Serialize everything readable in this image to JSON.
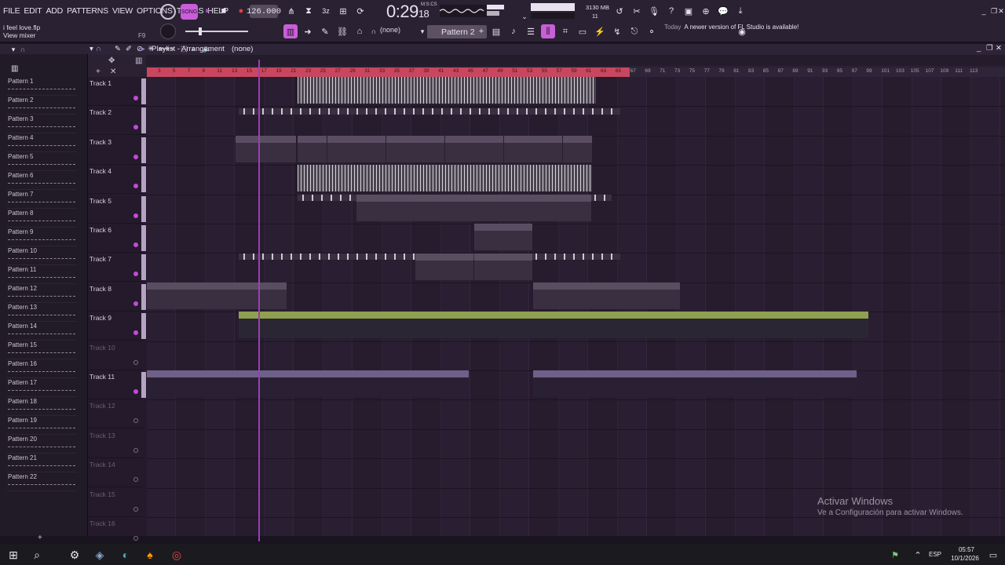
{
  "menu": [
    "FILE",
    "EDIT",
    "ADD",
    "PATTERNS",
    "VIEW",
    "OPTIONS",
    "TOOLS",
    "HELP"
  ],
  "project_file": "i feel love.flp",
  "hint": "View mixer",
  "hint_key": "F9",
  "tempo": "126.000",
  "clock": {
    "main": "0:29",
    "sub": "18",
    "label": "M:S:CS"
  },
  "memory": "3130 MB",
  "cpu": "11",
  "snap": "(none)",
  "pattern_selector": "Pattern 2",
  "notice": {
    "when": "Today",
    "text": "A newer version of FL Studio is available!"
  },
  "playlist": {
    "title": "Playlist - Arrangement",
    "arrangement": "(none)"
  },
  "ruler_ticks": [
    "3",
    "5",
    "7",
    "9",
    "11",
    "13",
    "15",
    "17",
    "19",
    "21",
    "23",
    "25",
    "27",
    "29",
    "31",
    "33",
    "35",
    "37",
    "39",
    "41",
    "43",
    "45",
    "47",
    "49",
    "51",
    "53",
    "55",
    "57",
    "59",
    "61",
    "63",
    "65",
    "67",
    "69",
    "71",
    "73",
    "75",
    "77",
    "79",
    "81",
    "83",
    "85",
    "87",
    "89",
    "91",
    "93",
    "95",
    "97",
    "99",
    "101",
    "103",
    "105",
    "107",
    "109",
    "111",
    "113"
  ],
  "patterns": [
    "Pattern 1",
    "Pattern 2",
    "Pattern 3",
    "Pattern 4",
    "Pattern 5",
    "Pattern 6",
    "Pattern 7",
    "Pattern 8",
    "Pattern 9",
    "Pattern 10",
    "Pattern 11",
    "Pattern 12",
    "Pattern 13",
    "Pattern 14",
    "Pattern 15",
    "Pattern 16",
    "Pattern 17",
    "Pattern 18",
    "Pattern 19",
    "Pattern 20",
    "Pattern 21",
    "Pattern 22"
  ],
  "tracks": [
    "Track 1",
    "Track 2",
    "Track 3",
    "Track 4",
    "Track 5",
    "Track 6",
    "Track 7",
    "Track 8",
    "Track 9",
    "Track 10",
    "Track 11",
    "Track 12",
    "Track 13",
    "Track 14",
    "Track 15",
    "Track 16"
  ],
  "clips": {
    "vox": "TPS - Voy... (124 BPM)",
    "patt12": "Patt...12",
    "patt19": "Patt...19",
    "patt17": "Patt...17",
    "patt18": "Patt...18",
    "patt13": "Patt...13",
    "patt14": "Patt...14",
    "patrn5a": "Pat...rn 5",
    "patrn5b": "Pat...rn 5",
    "patrn6a": "Pat...rn 6",
    "patrn6b": "Pat...rn 6",
    "p7a": "Pattern 7",
    "p7b": "Pattern 7",
    "eq": "Param. EQ 2 - Insert 15 - Band 1 freq",
    "pan1": "Insert 9 - Panning",
    "pan2": "Insert 9 - Panning"
  },
  "watermark": {
    "title": "Activar Windows",
    "sub": "Ve a Configuración para activar Windows."
  },
  "tray": {
    "lang": "ESP",
    "time": "05:57",
    "date": "10/1/2026"
  }
}
